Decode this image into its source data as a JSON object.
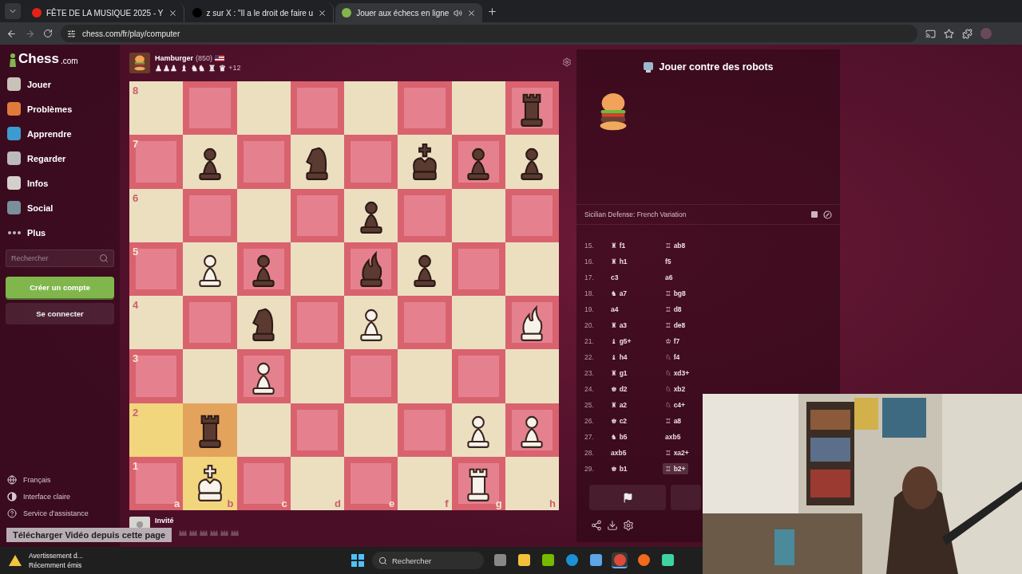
{
  "browser": {
    "tabs": [
      {
        "title": "FÊTE DE LA MUSIQUE 2025 - Y",
        "kind": "video",
        "selected": false
      },
      {
        "title": "z sur X : \"Il a le droit de faire u",
        "kind": "x",
        "selected": false
      },
      {
        "title": "Jouer aux échecs en ligne",
        "kind": "chess",
        "selected": true,
        "audio": true
      }
    ],
    "address": "chess.com/fr/play/computer"
  },
  "sidebar": {
    "logo": "Chess",
    "logo_suffix": ".com",
    "items": [
      {
        "label": "Jouer",
        "kind": "play"
      },
      {
        "label": "Problèmes",
        "kind": "puzzle"
      },
      {
        "label": "Apprendre",
        "kind": "learn"
      },
      {
        "label": "Regarder",
        "kind": "watch"
      },
      {
        "label": "Infos",
        "kind": "news"
      },
      {
        "label": "Social",
        "kind": "social"
      },
      {
        "label": "Plus",
        "kind": "more"
      }
    ],
    "search": {
      "placeholder": "Rechercher"
    },
    "signup": "Créer un compte",
    "login": "Se connecter",
    "footer": [
      {
        "label": "Français",
        "kind": "globe"
      },
      {
        "label": "Interface claire",
        "kind": "contrast"
      },
      {
        "label": "Service d'assistance",
        "kind": "help"
      }
    ]
  },
  "opponent": {
    "name": "Hamburger",
    "rating": "(850)",
    "captured": "♟♟♟ ♝ ♞♞ ♜ ♛",
    "advantage": "+12"
  },
  "player": {
    "name": "Invité"
  },
  "board": {
    "rank_labels": [
      "8",
      "7",
      "6",
      "5",
      "4",
      "3",
      "2",
      "1"
    ],
    "file_labels": [
      "a",
      "b",
      "c",
      "d",
      "e",
      "f",
      "g",
      "h"
    ],
    "ranks": [
      [
        {
          "highlighted": false
        },
        {
          "highlighted": false
        },
        {
          "highlighted": false
        },
        {
          "highlighted": false
        },
        {
          "highlighted": false
        },
        {
          "highlighted": false
        },
        {
          "highlighted": false
        },
        {
          "highlighted": false,
          "kind": "rook",
          "white": false
        }
      ],
      [
        {
          "highlighted": false
        },
        {
          "highlighted": false,
          "kind": "pawn",
          "white": false
        },
        {
          "highlighted": false
        },
        {
          "highlighted": false,
          "kind": "knight",
          "white": false
        },
        {
          "highlighted": false
        },
        {
          "highlighted": false,
          "kind": "king",
          "white": false
        },
        {
          "highlighted": false,
          "kind": "pawn",
          "white": false
        },
        {
          "highlighted": false,
          "kind": "pawn",
          "white": false
        }
      ],
      [
        {
          "highlighted": false
        },
        {
          "highlighted": false
        },
        {
          "highlighted": false
        },
        {
          "highlighted": false
        },
        {
          "highlighted": false,
          "kind": "pawn",
          "white": false
        },
        {
          "highlighted": false
        },
        {
          "highlighted": false
        },
        {
          "highlighted": false
        }
      ],
      [
        {
          "highlighted": false
        },
        {
          "highlighted": false,
          "kind": "pawn",
          "white": true
        },
        {
          "highlighted": false,
          "kind": "pawn",
          "white": false
        },
        {
          "highlighted": false
        },
        {
          "highlighted": false,
          "kind": "bishop",
          "white": false
        },
        {
          "highlighted": false,
          "kind": "pawn",
          "white": false
        },
        {
          "highlighted": false
        },
        {
          "highlighted": false
        }
      ],
      [
        {
          "highlighted": false
        },
        {
          "highlighted": false
        },
        {
          "highlighted": false,
          "kind": "knight",
          "white": false
        },
        {
          "highlighted": false
        },
        {
          "highlighted": false,
          "kind": "pawn",
          "white": true
        },
        {
          "highlighted": false
        },
        {
          "highlighted": false
        },
        {
          "highlighted": false,
          "kind": "bishop",
          "white": true
        }
      ],
      [
        {
          "highlighted": false
        },
        {
          "highlighted": false
        },
        {
          "highlighted": false,
          "kind": "pawn",
          "white": true
        },
        {
          "highlighted": false
        },
        {
          "highlighted": false
        },
        {
          "highlighted": false
        },
        {
          "highlighted": false
        },
        {
          "highlighted": false
        }
      ],
      [
        {
          "highlighted": true
        },
        {
          "highlighted": true,
          "kind": "rook",
          "white": false
        },
        {
          "highlighted": false
        },
        {
          "highlighted": false
        },
        {
          "highlighted": false
        },
        {
          "highlighted": false
        },
        {
          "highlighted": false,
          "kind": "pawn",
          "white": true
        },
        {
          "highlighted": false,
          "kind": "pawn",
          "white": true
        }
      ],
      [
        {
          "highlighted": false
        },
        {
          "highlighted": true,
          "kind": "king",
          "white": true
        },
        {
          "highlighted": false
        },
        {
          "highlighted": false
        },
        {
          "highlighted": false
        },
        {
          "highlighted": false
        },
        {
          "highlighted": false,
          "kind": "rook",
          "white": true
        },
        {
          "highlighted": false
        }
      ]
    ]
  },
  "panel": {
    "title": "Jouer contre des robots",
    "opening": "Sicilian Defense: French Variation",
    "moves": [
      {
        "number": "15.",
        "white": {
          "figure": "♜",
          "san": "f1",
          "selected": false
        },
        "black": {
          "figure": "♖",
          "san": "ab8",
          "selected": false
        }
      },
      {
        "number": "16.",
        "white": {
          "figure": "♜",
          "san": "h1",
          "selected": false
        },
        "black": {
          "san": "f5",
          "selected": false
        }
      },
      {
        "number": "17.",
        "white": {
          "san": "c3",
          "selected": false
        },
        "black": {
          "san": "a6",
          "selected": false
        }
      },
      {
        "number": "18.",
        "white": {
          "figure": "♞",
          "san": "a7",
          "selected": false
        },
        "black": {
          "figure": "♖",
          "san": "bg8",
          "selected": false
        }
      },
      {
        "number": "19.",
        "white": {
          "san": "a4",
          "selected": false
        },
        "black": {
          "figure": "♖",
          "san": "d8",
          "selected": false
        }
      },
      {
        "number": "20.",
        "white": {
          "figure": "♜",
          "san": "a3",
          "selected": false
        },
        "black": {
          "figure": "♖",
          "san": "de8",
          "selected": false
        }
      },
      {
        "number": "21.",
        "white": {
          "figure": "♝",
          "san": "g5+",
          "selected": false
        },
        "black": {
          "figure": "♔",
          "san": "f7",
          "selected": false
        }
      },
      {
        "number": "22.",
        "white": {
          "figure": "♝",
          "san": "h4",
          "selected": false
        },
        "black": {
          "figure": "♘",
          "san": "f4",
          "selected": false
        }
      },
      {
        "number": "23.",
        "white": {
          "figure": "♜",
          "san": "g1",
          "selected": false
        },
        "black": {
          "figure": "♘",
          "san": "xd3+",
          "selected": false
        }
      },
      {
        "number": "24.",
        "white": {
          "figure": "♚",
          "san": "d2",
          "selected": false
        },
        "black": {
          "figure": "♘",
          "san": "xb2",
          "selected": false
        }
      },
      {
        "number": "25.",
        "white": {
          "figure": "♜",
          "san": "a2",
          "selected": false
        },
        "black": {
          "figure": "♘",
          "san": "c4+",
          "selected": false
        }
      },
      {
        "number": "26.",
        "white": {
          "figure": "♚",
          "san": "c2",
          "selected": false
        },
        "black": {
          "figure": "♖",
          "san": "a8",
          "selected": false
        }
      },
      {
        "number": "27.",
        "white": {
          "figure": "♞",
          "san": "b5",
          "selected": false
        },
        "black": {
          "san": "axb5",
          "selected": false
        }
      },
      {
        "number": "28.",
        "white": {
          "san": "axb5",
          "selected": false
        },
        "black": {
          "figure": "♖",
          "san": "xa2+",
          "selected": false
        }
      },
      {
        "number": "29.",
        "white": {
          "figure": "♚",
          "san": "b1",
          "selected": false
        },
        "black": {
          "figure": "♖",
          "san": "b2+",
          "selected": true
        }
      }
    ]
  },
  "download_bar": "Télécharger Vidéo depuis cette page",
  "notification": {
    "title": "Avertissement d...",
    "subtitle": "Récemment émis"
  },
  "taskbar": {
    "search": {
      "placeholder": "Rechercher"
    },
    "apps": [
      {
        "kind": "taskview",
        "selected": false
      },
      {
        "kind": "folder",
        "selected": false
      },
      {
        "kind": "nvidia",
        "selected": false
      },
      {
        "kind": "edge",
        "selected": false
      },
      {
        "kind": "store",
        "selected": false
      },
      {
        "kind": "chrome",
        "selected": true
      },
      {
        "kind": "firefox",
        "selected": false
      },
      {
        "kind": "bot",
        "selected": false
      }
    ]
  }
}
